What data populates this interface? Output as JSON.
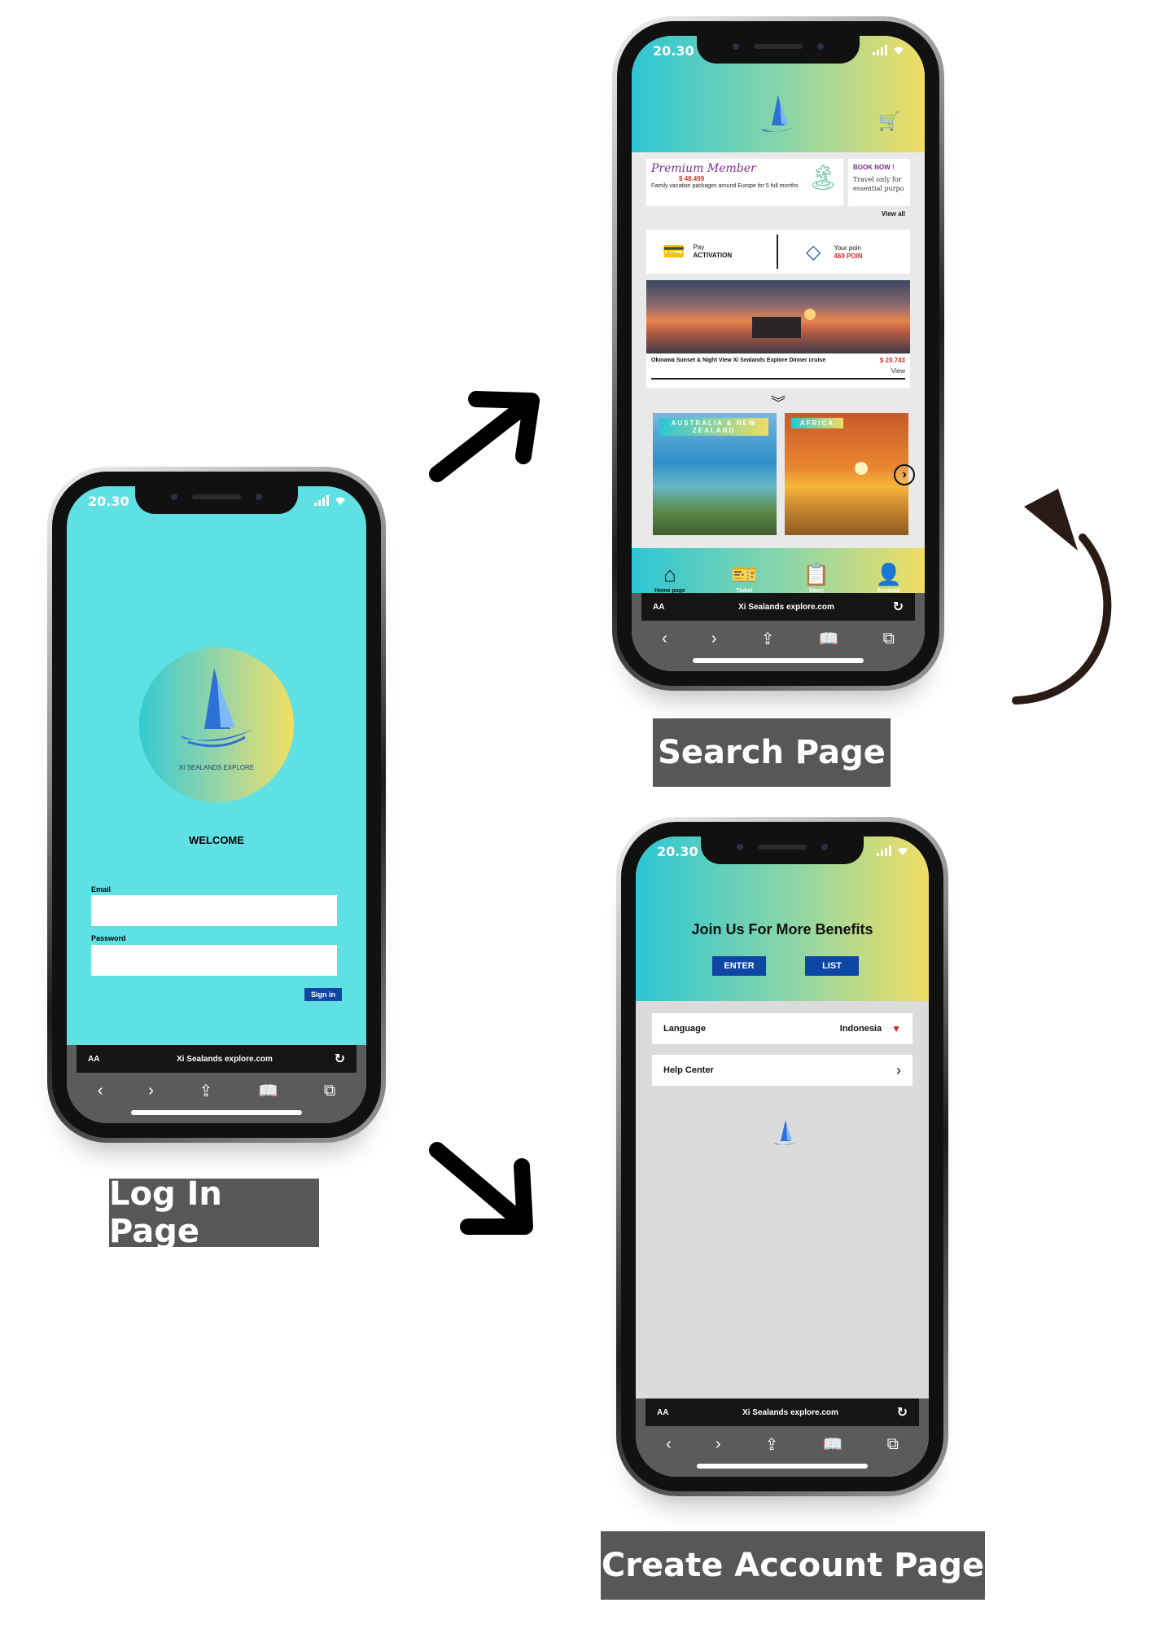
{
  "login": {
    "time": "20.30",
    "brand": "XI SEALANDS EXPLORE",
    "welcome": "WELCOME",
    "email_label": "Email",
    "password_label": "Password",
    "signin": "Sign in",
    "browser": {
      "aa": "AA",
      "url": "Xi Sealands explore.com"
    },
    "caption": "Log In Page"
  },
  "search": {
    "time": "20.30",
    "promo": {
      "title": "Premium Member",
      "price": "$ 48.499",
      "desc": "Family vacation packages around Europe for 5 full months"
    },
    "book": {
      "title": "BOOK NOW !",
      "desc": "Travel only for essential purpo"
    },
    "view_all": "View all",
    "pay": {
      "label": "Pay",
      "value": "ACTIVATION"
    },
    "points": {
      "label": "Your poin",
      "value": "469 POIN"
    },
    "feature": {
      "title": "Okinawa Sunset & Night View Xi Sealands Explore Dinner cruise",
      "price": "$ 29.743",
      "action": "View"
    },
    "destinations": [
      {
        "label": "AUSTRALIA & NEW ZEALAND"
      },
      {
        "label": "AFRICA"
      }
    ],
    "tabs": [
      {
        "label": "Home page",
        "icon": "home-icon"
      },
      {
        "label": "Ticket",
        "icon": "ticket-icon"
      },
      {
        "label": "Story",
        "icon": "story-icon"
      },
      {
        "label": "Account",
        "icon": "account-icon"
      }
    ],
    "browser": {
      "aa": "AA",
      "url": "Xi Sealands explore.com"
    },
    "caption": "Search Page"
  },
  "account": {
    "time": "20.30",
    "headline": "Join Us For More Benefits",
    "enter": "ENTER",
    "list": "LIST",
    "language_label": "Language",
    "language_value": "Indonesia",
    "help": "Help Center",
    "browser": {
      "aa": "AA",
      "url": "Xi Sealands explore.com"
    },
    "caption": "Create Account Page"
  },
  "colors": {
    "cyan": "#5fe0e3",
    "gradient_start": "#2cc6d5",
    "gradient_end": "#f1dd63",
    "button_blue": "#0e46a3",
    "caption_bg": "#575757"
  }
}
